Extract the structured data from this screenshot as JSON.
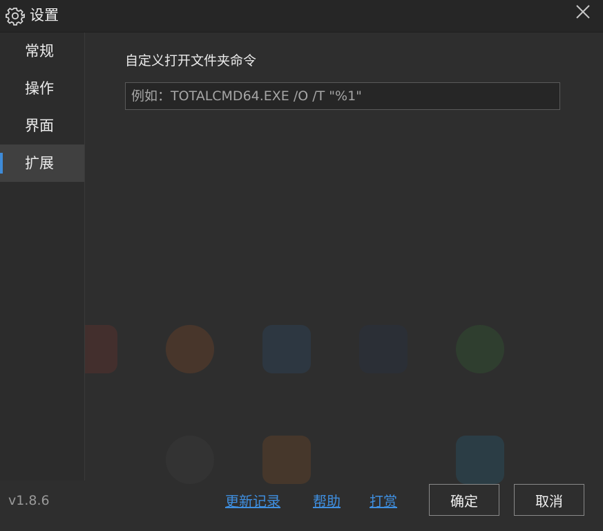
{
  "window": {
    "title": "设置",
    "icon": "gear-icon",
    "close_icon": "close-icon"
  },
  "sidebar": {
    "items": [
      {
        "label": "常规",
        "active": false
      },
      {
        "label": "操作",
        "active": false
      },
      {
        "label": "界面",
        "active": false
      },
      {
        "label": "扩展",
        "active": true
      }
    ]
  },
  "main": {
    "section_label": "自定义打开文件夹命令",
    "command_input": {
      "value": "",
      "placeholder": "例如：TOTALCMD64.EXE /O /T \"%1\""
    }
  },
  "footer": {
    "version": "v1.8.6",
    "links": {
      "changelog": "更新记录",
      "help": "帮助",
      "donate": "打赏"
    },
    "ok_label": "确定",
    "cancel_label": "取消"
  },
  "colors": {
    "accent": "#3e8bd8",
    "link": "#3f8fe0",
    "background": "#2e2e2e"
  }
}
